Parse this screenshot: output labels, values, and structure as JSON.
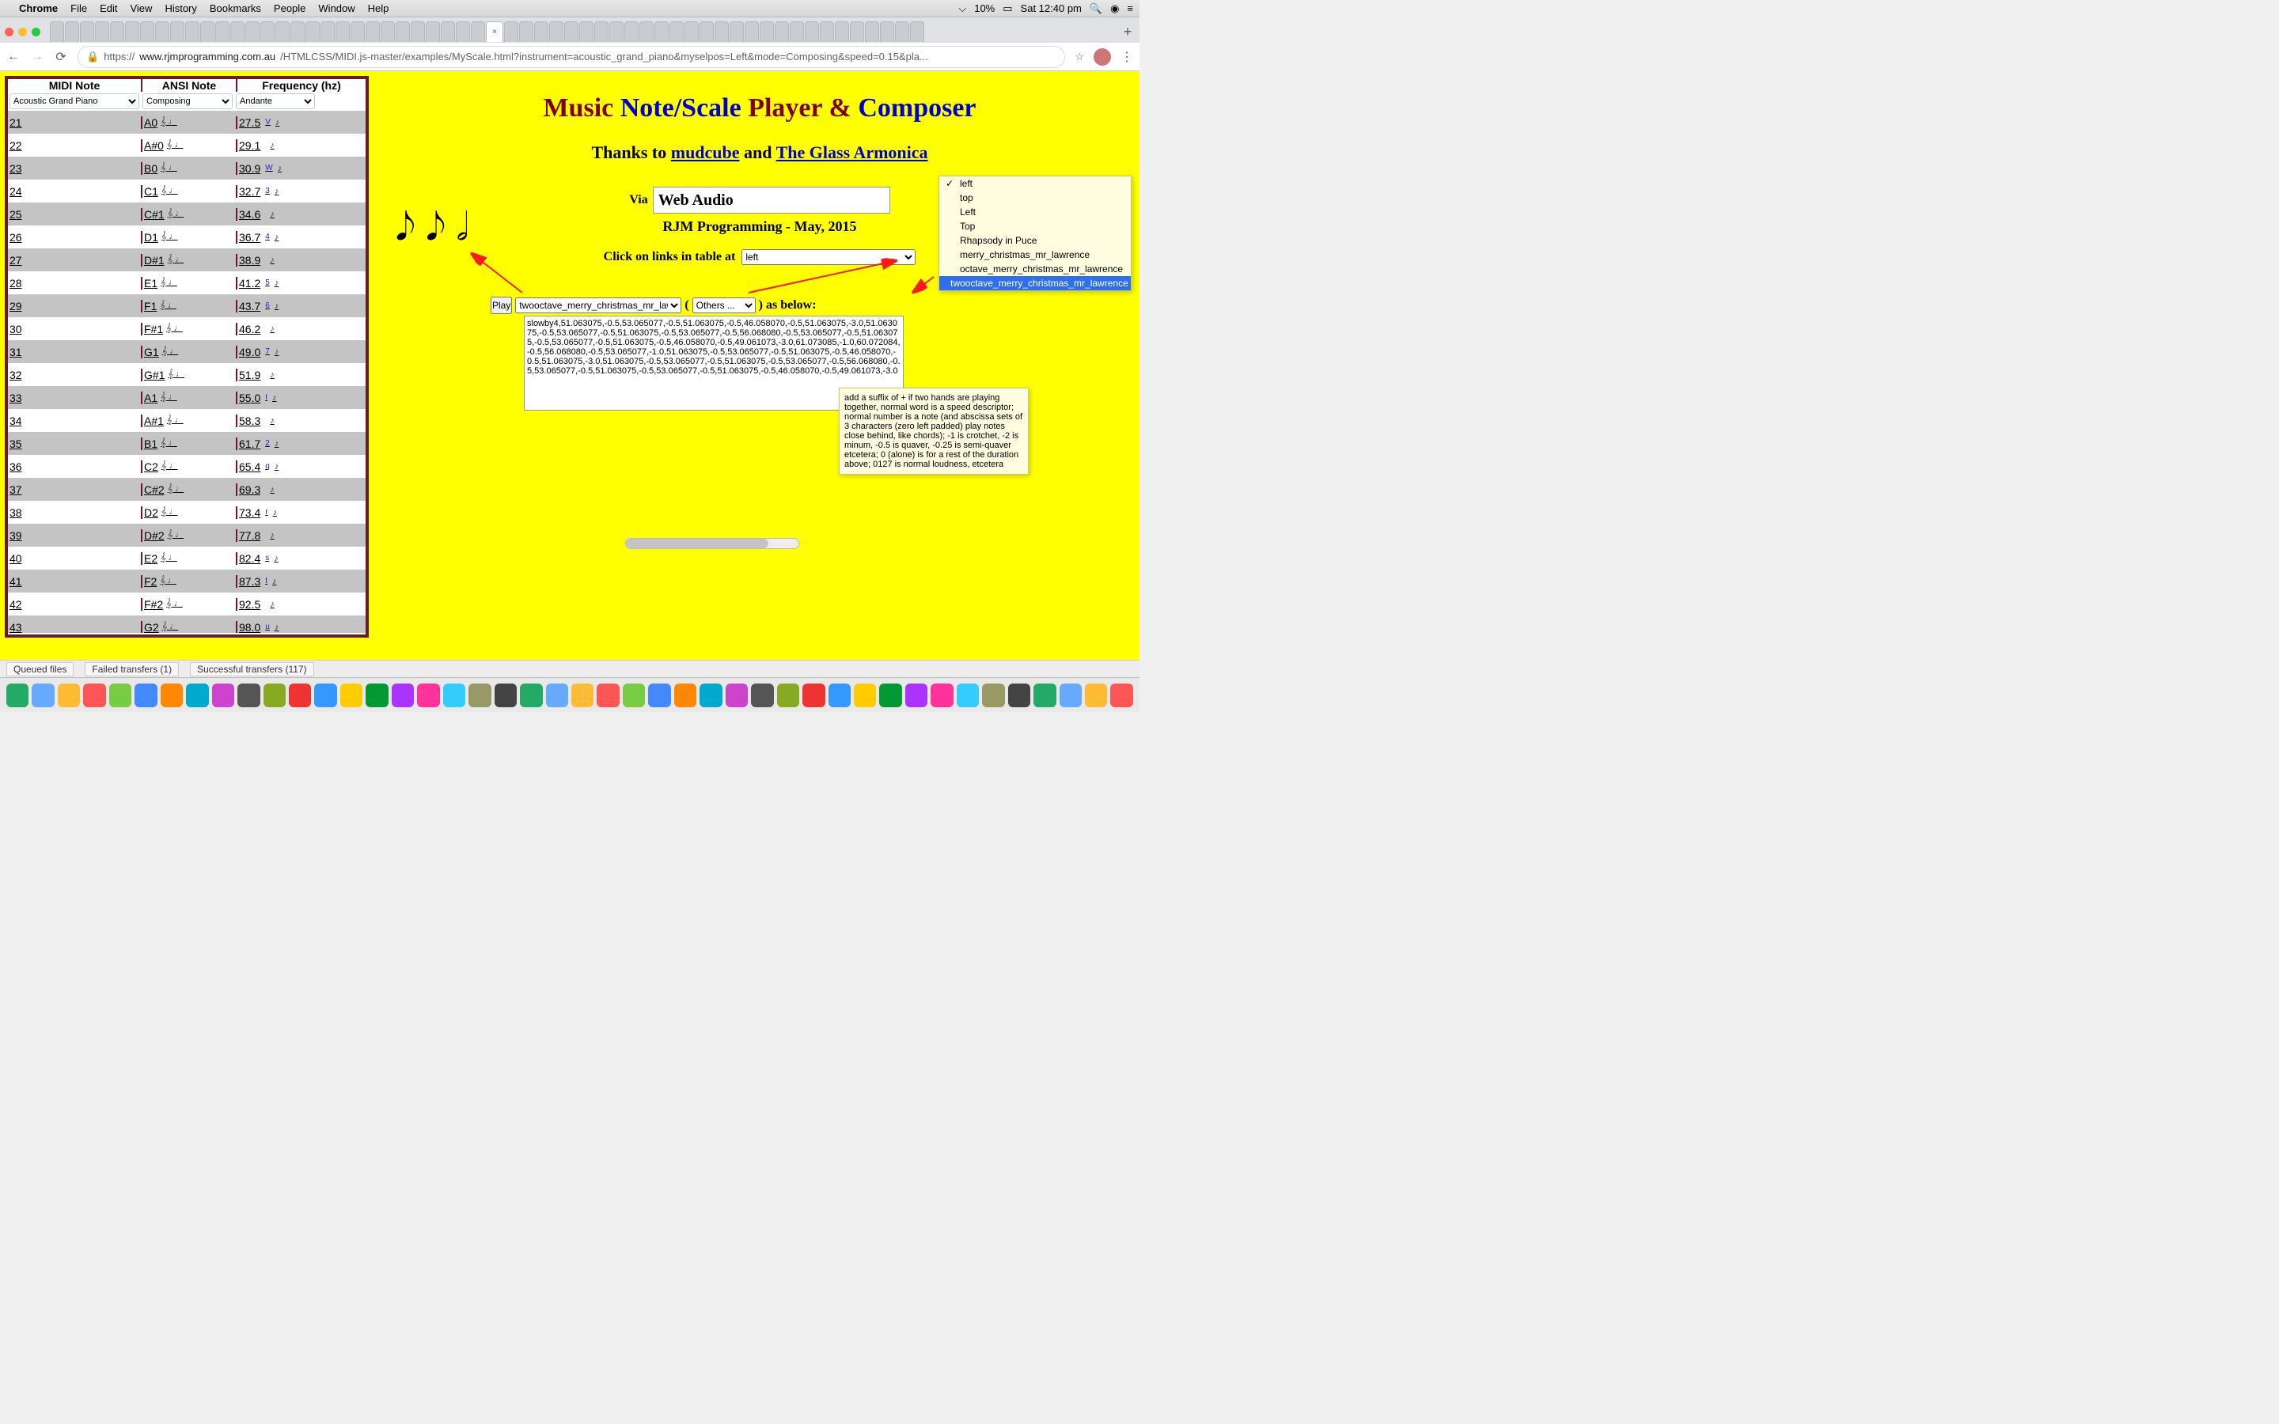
{
  "mac_menu": {
    "items": [
      "Chrome",
      "File",
      "Edit",
      "View",
      "History",
      "Bookmarks",
      "People",
      "Window",
      "Help"
    ],
    "battery": "10%",
    "clock": "Sat 12:40 pm"
  },
  "chrome": {
    "url_prefix": "https://",
    "url_host": "www.rjmprogramming.com.au",
    "url_path": "/HTMLCSS/MIDI.js-master/examples/MyScale.html?instrument=acoustic_grand_piano&myselpos=Left&mode=Composing&speed=0.15&pla..."
  },
  "table": {
    "headers": {
      "midi": "MIDI Note",
      "ansi": "ANSI Note",
      "freq": "Frequency (hz)"
    },
    "selects": {
      "instrument": "Acoustic Grand Piano",
      "mode": "Composing",
      "tempo": "Andante"
    },
    "rows": [
      {
        "midi": "21",
        "ansi": "A0",
        "freq": "27.5",
        "sub": "V"
      },
      {
        "midi": "22",
        "ansi": "A#0",
        "freq": "29.1",
        "sub": ""
      },
      {
        "midi": "23",
        "ansi": "B0",
        "freq": "30.9",
        "sub": "W"
      },
      {
        "midi": "24",
        "ansi": "C1",
        "freq": "32.7",
        "sub": "3"
      },
      {
        "midi": "25",
        "ansi": "C#1",
        "freq": "34.6",
        "sub": ""
      },
      {
        "midi": "26",
        "ansi": "D1",
        "freq": "36.7",
        "sub": "4"
      },
      {
        "midi": "27",
        "ansi": "D#1",
        "freq": "38.9",
        "sub": ""
      },
      {
        "midi": "28",
        "ansi": "E1",
        "freq": "41.2",
        "sub": "5"
      },
      {
        "midi": "29",
        "ansi": "F1",
        "freq": "43.7",
        "sub": "6"
      },
      {
        "midi": "30",
        "ansi": "F#1",
        "freq": "46.2",
        "sub": ""
      },
      {
        "midi": "31",
        "ansi": "G1",
        "freq": "49.0",
        "sub": "7"
      },
      {
        "midi": "32",
        "ansi": "G#1",
        "freq": "51.9",
        "sub": ""
      },
      {
        "midi": "33",
        "ansi": "A1",
        "freq": "55.0",
        "sub": "I"
      },
      {
        "midi": "34",
        "ansi": "A#1",
        "freq": "58.3",
        "sub": ""
      },
      {
        "midi": "35",
        "ansi": "B1",
        "freq": "61.7",
        "sub": "2"
      },
      {
        "midi": "36",
        "ansi": "C2",
        "freq": "65.4",
        "sub": "q"
      },
      {
        "midi": "37",
        "ansi": "C#2",
        "freq": "69.3",
        "sub": ""
      },
      {
        "midi": "38",
        "ansi": "D2",
        "freq": "73.4",
        "sub": "r"
      },
      {
        "midi": "39",
        "ansi": "D#2",
        "freq": "77.8",
        "sub": ""
      },
      {
        "midi": "40",
        "ansi": "E2",
        "freq": "82.4",
        "sub": "s"
      },
      {
        "midi": "41",
        "ansi": "F2",
        "freq": "87.3",
        "sub": "t"
      },
      {
        "midi": "42",
        "ansi": "F#2",
        "freq": "92.5",
        "sub": ""
      },
      {
        "midi": "43",
        "ansi": "G2",
        "freq": "98.0",
        "sub": "u"
      }
    ]
  },
  "page": {
    "title_a": "Music ",
    "title_b": "Note/Scale",
    "title_c": " Player & ",
    "title_d": "Composer",
    "thanks_prefix": "Thanks to ",
    "thanks_link1": "mudcube",
    "thanks_and": " and ",
    "thanks_link2": "The Glass Armonica",
    "via": "Via",
    "webaudio": "Web Audio",
    "rjm": "RJM Programming - May, 2015",
    "click_text": "Click on links in table at",
    "position_value": "left",
    "play_btn": "Play",
    "song_select": "twooctave_merry_christmas_mr_lawrence",
    "others_label": "Others ...",
    "paren_open": " ( ",
    "paren_close": ") as below:",
    "textarea": "slowby4,51.063075,-0.5,53.065077,-0.5,51.063075,-0.5,46.058070,-0.5,51.063075,-3.0,51.063075,-0.5,53.065077,-0.5,51.063075,-0.5,53.065077,-0.5,56.068080,-0.5,53.065077,-0.5,51.063075,-0.5,53.065077,-0.5,51.063075,-0.5,46.058070,-0.5,49.061073,-3.0,61.073085,-1.0,60.072084,-0.5,56.068080,-0.5,53.065077,-1.0,51.063075,-0.5,53.065077,-0.5,51.063075,-0.5,46.058070,-0.5,51.063075,-3.0,51.063075,-0.5,53.065077,-0.5,51.063075,-0.5,53.065077,-0.5,56.068080,-0.5,53.065077,-0.5,51.063075,-0.5,53.065077,-0.5,51.063075,-0.5,46.058070,-0.5,49.061073,-3.0"
  },
  "popup": {
    "items": [
      {
        "label": "left",
        "checked": true
      },
      {
        "label": "top"
      },
      {
        "label": "Left"
      },
      {
        "label": "Top"
      },
      {
        "label": "Rhapsody in Puce"
      },
      {
        "label": "merry_christmas_mr_lawrence"
      },
      {
        "label": "octave_merry_christmas_mr_lawrence"
      },
      {
        "label": "twooctave_merry_christmas_mr_lawrence",
        "selected": true
      }
    ]
  },
  "tooltip": "add a suffix of + if two hands are playing together, normal word is a speed descriptor; normal number is a note (and abscissa sets of 3 characters (zero left padded) play notes close behind, like chords); -1 is crotchet, -2 is minum, -0.5 is quaver, -0.25 is semi-quaver etcetera; 0 (alone) is for a rest of the duration above; 0127 is normal loudness, etcetera",
  "statusbar": {
    "queued": "Queued files",
    "failed": "Failed transfers (1)",
    "success": "Successful transfers (117)"
  }
}
